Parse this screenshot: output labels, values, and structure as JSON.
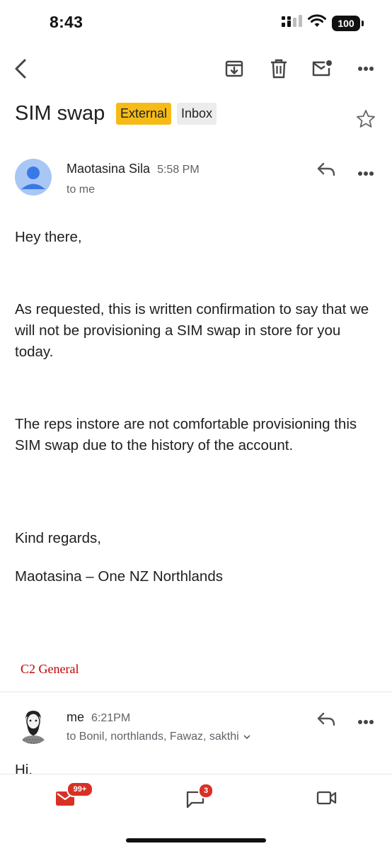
{
  "status_bar": {
    "time": "8:43",
    "battery": "100"
  },
  "toolbar": {
    "icons": [
      "back-arrow-icon",
      "archive-icon",
      "trash-icon",
      "mark-unread-icon",
      "more-icon"
    ]
  },
  "email": {
    "subject": "SIM swap",
    "labels": {
      "external": "External",
      "inbox": "Inbox"
    },
    "label_colors": {
      "external": "#f7bb17",
      "inbox": "#ececec"
    }
  },
  "message1": {
    "sender": "Maotasina Sila",
    "time": "5:58 PM",
    "to": "to me",
    "body": {
      "greeting": "Hey there,",
      "para1": "As requested, this is written confirmation to say that we will not be provisioning a SIM swap in store for you today.",
      "para2": "The reps instore are not comfortable provisioning this SIM swap due to the history of the account.",
      "closing": "Kind regards,",
      "signoff": "Maotasina – One NZ Northlands"
    },
    "classification": "C2 General",
    "classification_color": "#c00000"
  },
  "message2": {
    "sender": "me",
    "time": "6:21PM",
    "to": "to Bonil, northlands, Fawaz, sakthi",
    "preview": "Hi,"
  },
  "bottom_nav": {
    "mail_badge": "99+",
    "chat_badge": "3",
    "accent": "#d93025"
  }
}
